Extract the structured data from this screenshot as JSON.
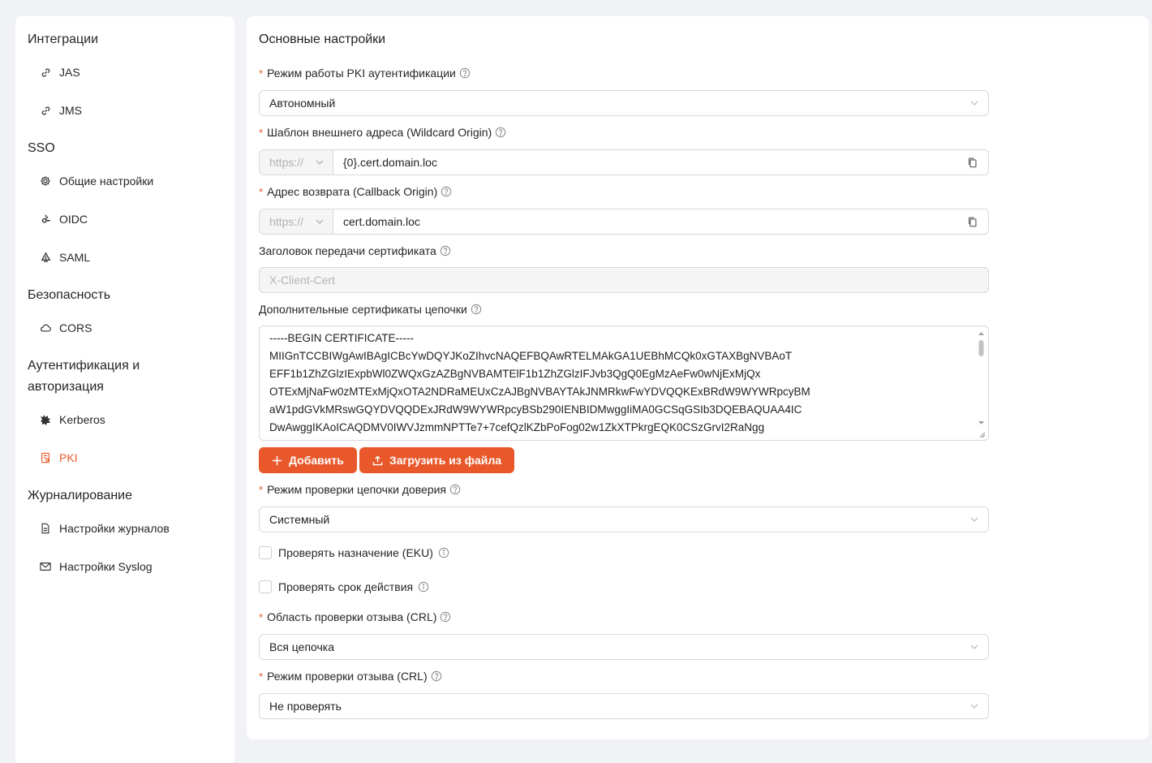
{
  "sidebar": {
    "groups": [
      {
        "label": "Интеграции",
        "items": [
          {
            "label": "JAS",
            "icon": "link-icon"
          },
          {
            "label": "JMS",
            "icon": "link-icon"
          }
        ]
      },
      {
        "label": "SSO",
        "items": [
          {
            "label": "Общие настройки",
            "icon": "gear-icon"
          },
          {
            "label": "OIDC",
            "icon": "oidc-icon"
          },
          {
            "label": "SAML",
            "icon": "saml-icon"
          }
        ]
      },
      {
        "label": "Безопасность",
        "items": [
          {
            "label": "CORS",
            "icon": "cloud-icon"
          }
        ]
      },
      {
        "label": "Аутентификация и авторизация",
        "items": [
          {
            "label": "Kerberos",
            "icon": "kerberos-icon"
          },
          {
            "label": "PKI",
            "icon": "certificate-icon",
            "active": true
          }
        ]
      },
      {
        "label": "Журналирование",
        "items": [
          {
            "label": "Настройки журналов",
            "icon": "file-icon"
          },
          {
            "label": "Настройки Syslog",
            "icon": "mail-icon"
          }
        ]
      }
    ]
  },
  "main": {
    "title": "Основные настройки",
    "pki_mode": {
      "label": "Режим работы PKI аутентификации",
      "value": "Автономный"
    },
    "wildcard_origin": {
      "label": "Шаблон внешнего адреса (Wildcard Origin)",
      "protocol": "https://",
      "value": "{0}.cert.domain.loc"
    },
    "callback_origin": {
      "label": "Адрес возврата (Callback Origin)",
      "protocol": "https://",
      "value": "cert.domain.loc"
    },
    "cert_header": {
      "label": "Заголовок передачи сертификата",
      "placeholder": "X-Client-Cert"
    },
    "chain_certs": {
      "label": "Дополнительные сертификаты цепочки",
      "lines": [
        "-----BEGIN CERTIFICATE-----",
        "MIIGnTCCBIWgAwIBAgICBcYwDQYJKoZIhvcNAQEFBQAwRTELMAkGA1UEBhMCQk0xGTAXBgNVBAoT",
        "EFF1b1ZhZGlzIExpbWl0ZWQxGzAZBgNVBAMTElF1b1ZhZGlzIFJvb3QgQ0EgMzAeFw0wNjExMjQx",
        "OTExMjNaFw0zMTExMjQxOTA2NDRaMEUxCzAJBgNVBAYTAkJNMRkwFwYDVQQKExBRdW9WYWRpcyBM",
        "aW1pdGVkMRswGQYDVQQDExJRdW9WYWRpcyBSb290IENBIDMwggIiMA0GCSqGSIb3DQEBAQUAA4IC",
        "DwAwggIKAoICAQDMV0IWVJzmmNPTTe7+7cefQzlKZbPoFog02w1ZkXTPkrgEQK0CSzGrvI2RaNgg"
      ]
    },
    "buttons": {
      "add": "Добавить",
      "upload": "Загрузить из файла"
    },
    "trust_chain_mode": {
      "label": "Режим проверки цепочки доверия",
      "value": "Системный"
    },
    "check_eku": {
      "label": "Проверять назначение (EKU)",
      "checked": false
    },
    "check_validity": {
      "label": "Проверять срок действия",
      "checked": false
    },
    "crl_scope": {
      "label": "Область проверки отзыва (CRL)",
      "value": "Вся цепочка"
    },
    "crl_mode": {
      "label": "Режим проверки отзыва (CRL)",
      "value": "Не проверять"
    }
  },
  "colors": {
    "accent": "#e8582a",
    "required": "#e8582a"
  }
}
